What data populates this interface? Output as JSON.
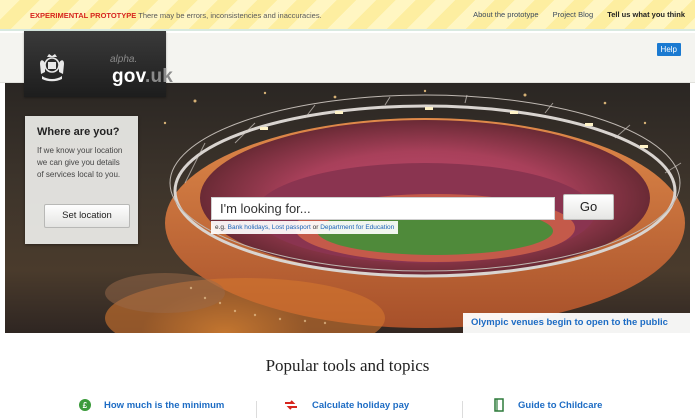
{
  "banner": {
    "flag": "EXPERIMENTAL PROTOTYPE",
    "notice": "There may be errors, inconsistencies and inaccuracies.",
    "links": [
      "About the prototype",
      "Project Blog",
      "Tell us what you think"
    ]
  },
  "header": {
    "logo_alpha": "alpha.",
    "logo_name": "gov",
    "logo_suffix": ".uk",
    "help_label": "Help"
  },
  "location": {
    "title": "Where are you?",
    "text": "If we know your location we can give you details of services local to you.",
    "button_label": "Set location"
  },
  "search": {
    "value": "I'm looking for...",
    "button_label": "Go",
    "examples_prefix": "e.g.",
    "example_1": "Bank holidays,",
    "example_2": "Lost passport",
    "examples_or": "or",
    "example_3": "Department for Education"
  },
  "hero": {
    "feature_link": "Olympic venues begin to open to the public"
  },
  "popular": {
    "title": "Popular tools and topics",
    "items": [
      {
        "label": "How much is the minimum",
        "icon": "money-icon",
        "color": "#3a9a3a"
      },
      {
        "label": "Calculate holiday pay",
        "icon": "holiday-icon",
        "color": "#d7261e"
      },
      {
        "label": "Guide to Childcare",
        "icon": "book-icon",
        "color": "#2d7a3a"
      }
    ]
  },
  "colors": {
    "link_blue": "#1d6cc4",
    "help_blue": "#1b7ad1",
    "flag_red": "#d7261e"
  }
}
